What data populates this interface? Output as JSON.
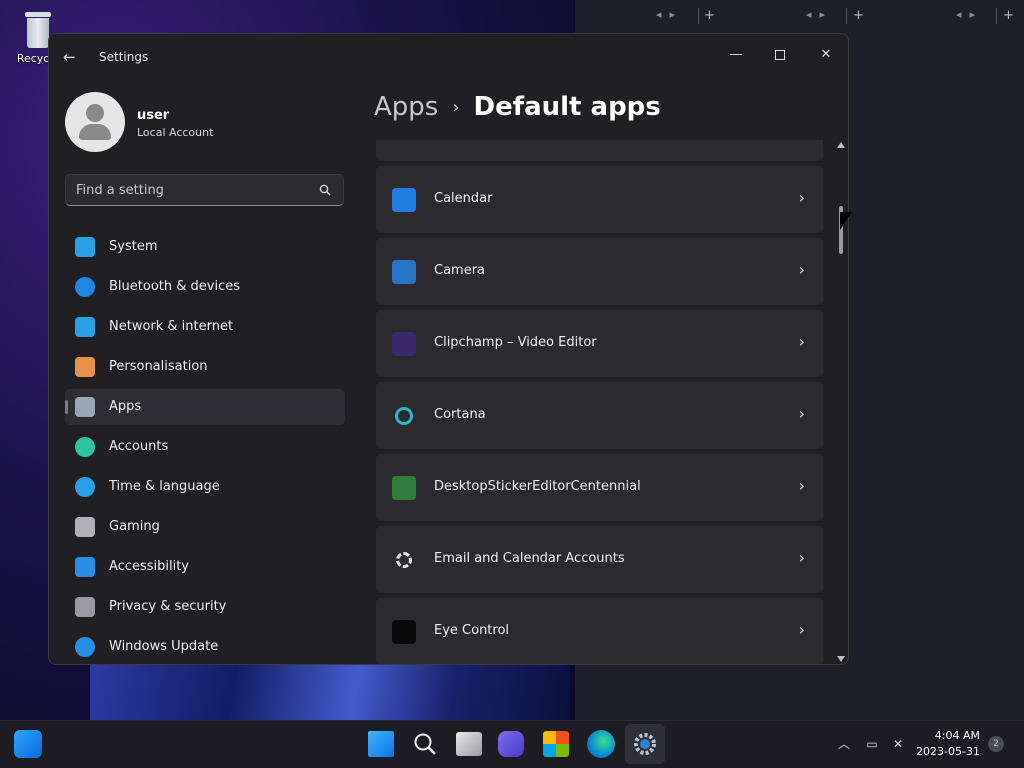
{
  "desktop": {
    "recycle_label": "Recycle"
  },
  "window": {
    "title": "Settings",
    "controls": {
      "minimize": "—",
      "close": "✕"
    }
  },
  "profile": {
    "name": "user",
    "account_type": "Local Account"
  },
  "search": {
    "placeholder": "Find a setting"
  },
  "nav": {
    "items": [
      {
        "label": "System",
        "icon": "monitor-icon",
        "color": "#2aa0e6"
      },
      {
        "label": "Bluetooth & devices",
        "icon": "bluetooth-icon",
        "color": "#1e88e5"
      },
      {
        "label": "Network & internet",
        "icon": "wifi-icon",
        "color": "#2aa0e6"
      },
      {
        "label": "Personalisation",
        "icon": "brush-icon",
        "color": "#e8914a"
      },
      {
        "label": "Apps",
        "icon": "apps-icon",
        "color": "#9aa6b8",
        "active": true
      },
      {
        "label": "Accounts",
        "icon": "person-icon",
        "color": "#2ec4a0"
      },
      {
        "label": "Time & language",
        "icon": "globe-clock-icon",
        "color": "#2aa0e6"
      },
      {
        "label": "Gaming",
        "icon": "gamepad-icon",
        "color": "#b0b0b8"
      },
      {
        "label": "Accessibility",
        "icon": "accessibility-icon",
        "color": "#2a8ee6"
      },
      {
        "label": "Privacy & security",
        "icon": "shield-icon",
        "color": "#9a9aa6"
      },
      {
        "label": "Windows Update",
        "icon": "update-icon",
        "color": "#2a8ee6"
      }
    ]
  },
  "breadcrumb": {
    "parent": "Apps",
    "separator": "›",
    "current": "Default apps"
  },
  "apps": [
    {
      "label": "Calendar",
      "icon": "calendar-icon",
      "color": "#1e7fe0"
    },
    {
      "label": "Camera",
      "icon": "camera-icon",
      "color": "#2a74c8"
    },
    {
      "label": "Clipchamp – Video Editor",
      "icon": "clipchamp-icon",
      "color": "#3b2a6a"
    },
    {
      "label": "Cortana",
      "icon": "cortana-icon",
      "color": "#2b2b2f"
    },
    {
      "label": "DesktopStickerEditorCentennial",
      "icon": "sticker-editor-icon",
      "color": "#2f7d3a"
    },
    {
      "label": "Email and Calendar Accounts",
      "icon": "gear-icon",
      "color": "#2b2b2f"
    },
    {
      "label": "Eye Control",
      "icon": "eye-control-icon",
      "color": "#0a0a0a"
    }
  ],
  "chevron": "›",
  "system_tray": {
    "time": "4:04 AM",
    "date": "2023-05-31",
    "notifications": "2"
  }
}
